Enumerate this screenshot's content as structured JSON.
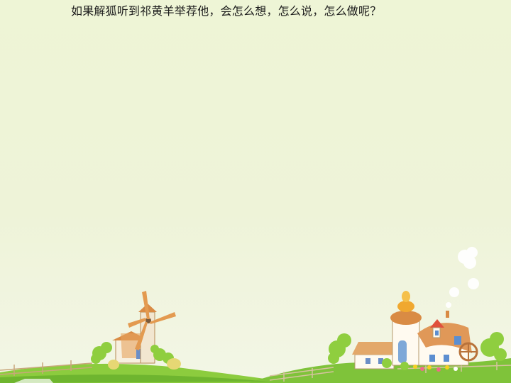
{
  "slide": {
    "question": "如果解狐听到祁黄羊举荐他，会怎么想，怎么说，怎么做呢？"
  },
  "illustration": {
    "left_icon": "windmill-icon",
    "right_icon": "farmhouse-icon",
    "cloud_icon": "cloud-icon",
    "colors": {
      "grass": "#7cc43a",
      "roof": "#d98b44",
      "tree": "#8fce3f"
    }
  }
}
